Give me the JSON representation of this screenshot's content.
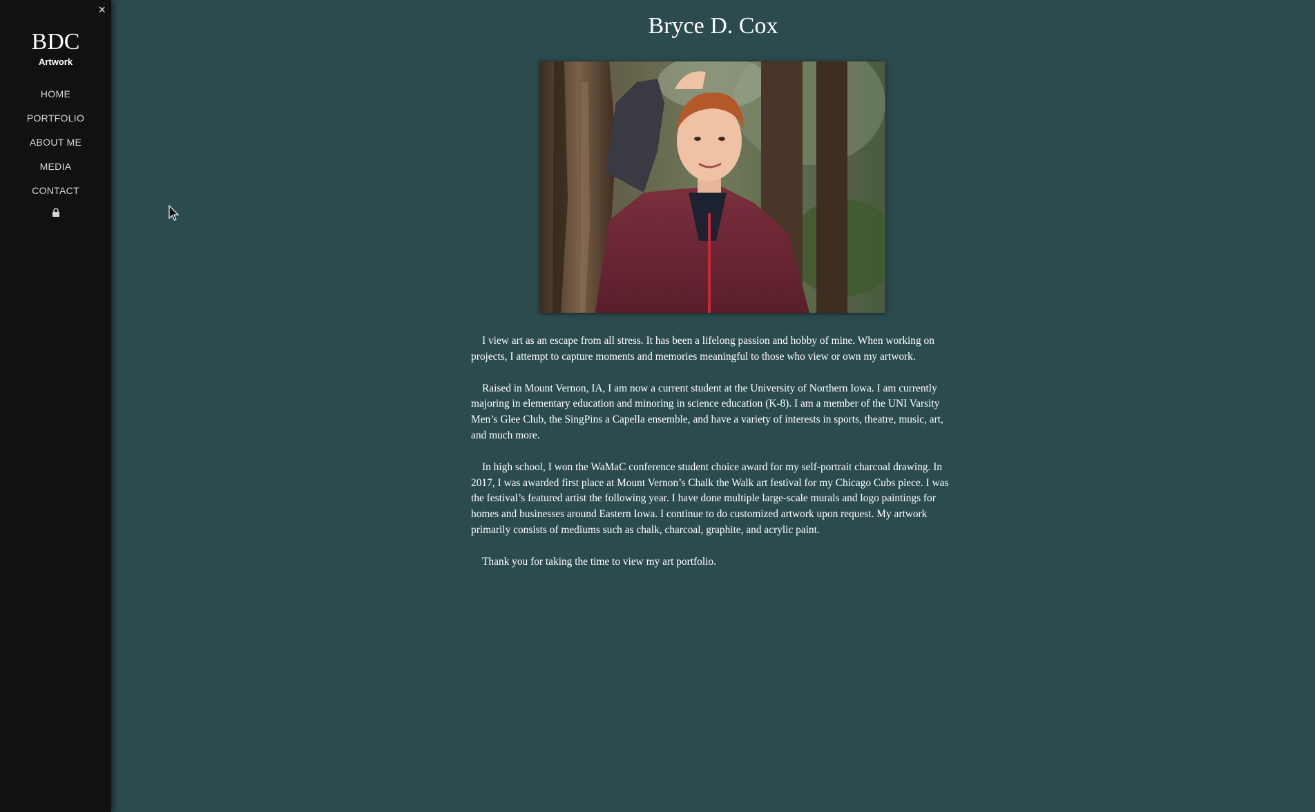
{
  "sidebar": {
    "close_icon": "×",
    "logo": "BDC",
    "logo_sub": "Artwork",
    "nav_items": [
      {
        "label": "HOME"
      },
      {
        "label": "PORTFOLIO"
      },
      {
        "label": "ABOUT ME"
      },
      {
        "label": "MEDIA"
      },
      {
        "label": "CONTACT"
      }
    ],
    "lock_icon": "lock-icon"
  },
  "main": {
    "title": "Bryce D. Cox",
    "photo_icon": "portrait-photo",
    "paragraphs": [
      "I view art as an escape from all stress. It has been a lifelong passion and hobby of mine. When working on projects, I attempt to capture moments and memories meaningful to those who view or own my artwork.",
      "Raised in Mount Vernon, IA, I am now a current student at the University of Northern Iowa. I am currently majoring in elementary education and minoring in science education (K-8). I am a member of the UNI Varsity Men’s Glee Club, the SingPins a Capella ensemble, and have a variety of interests in sports, theatre, music, art, and much more.",
      "In high school, I won the WaMaC conference student choice award for my self-portrait charcoal drawing. In 2017, I was awarded first place at Mount Vernon’s Chalk the Walk art festival for my Chicago Cubs piece. I was the festival’s featured artist the following year. I have done multiple large-scale murals and logo paintings for homes and businesses around Eastern Iowa. I continue to do customized artwork upon request. My artwork primarily consists of mediums such as chalk, charcoal, graphite, and acrylic paint.",
      "Thank you for taking the time to view my art portfolio."
    ]
  },
  "colors": {
    "background": "#2c4b4f",
    "sidebar": "#111111",
    "text": "#ffffff"
  }
}
